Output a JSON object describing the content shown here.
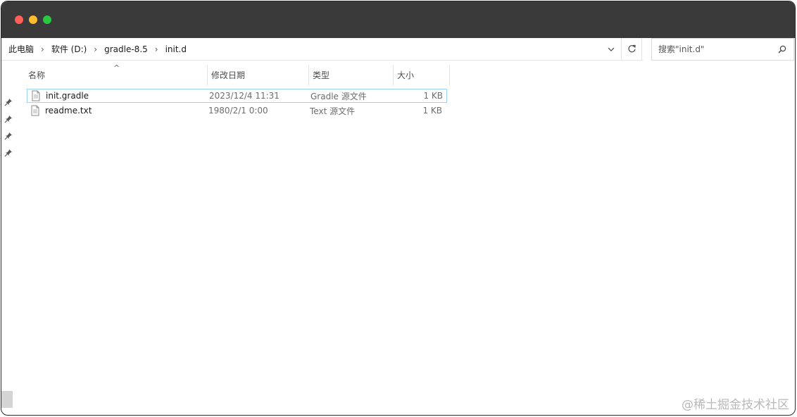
{
  "address": {
    "breadcrumbs": [
      "此电脑",
      "软件 (D:)",
      "gradle-8.5",
      "init.d"
    ]
  },
  "search": {
    "placeholder": "搜索\"init.d\""
  },
  "columns": {
    "name": "名称",
    "date": "修改日期",
    "type": "类型",
    "size": "大小"
  },
  "files": [
    {
      "name": "init.gradle",
      "date": "2023/12/4 11:31",
      "type": "Gradle 源文件",
      "size": "1 KB",
      "selected": true
    },
    {
      "name": "readme.txt",
      "date": "1980/2/1 0:00",
      "type": "Text 源文件",
      "size": "1 KB",
      "selected": false
    }
  ],
  "watermark": "@稀土掘金技术社区",
  "colors": {
    "titlebar": "#3a3a3a",
    "close": "#fe5f57",
    "minimize": "#febc2e",
    "maximize": "#28c840",
    "selection_border": "#99d1ff"
  },
  "icons": {
    "dropdown": "chevron-down-icon",
    "refresh": "refresh-icon",
    "search": "search-icon",
    "pin": "pin-icon",
    "file": "file-icon"
  }
}
